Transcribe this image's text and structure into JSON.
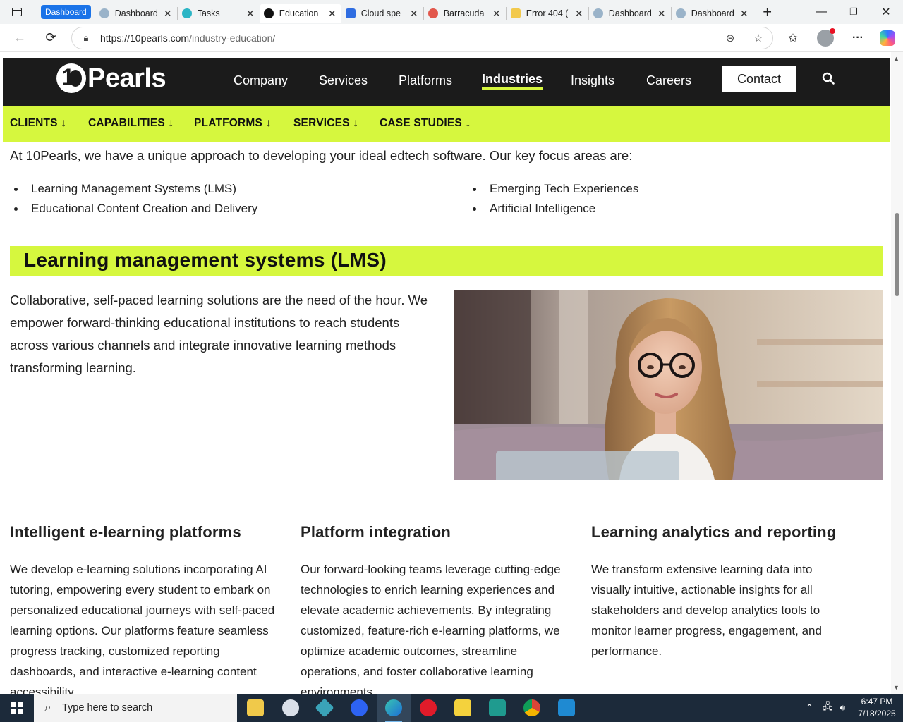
{
  "browser": {
    "group_label": "Dashboard",
    "tabs": [
      {
        "label": "Dashboard",
        "favicon_color": "#9ab3c9",
        "active": false
      },
      {
        "label": "Tasks",
        "favicon_color": "#2bb5c5",
        "active": false
      },
      {
        "label": "Education",
        "favicon_color": "#111111",
        "active": true
      },
      {
        "label": "Cloud spe",
        "favicon_color": "#2f6de1",
        "active": false
      },
      {
        "label": "Barracuda",
        "favicon_color": "#e2574c",
        "active": false
      },
      {
        "label": "Error 404 (",
        "favicon_color": "#f2c94c",
        "active": false
      },
      {
        "label": "Dashboard",
        "favicon_color": "#9ab3c9",
        "active": false
      },
      {
        "label": "Dashboard",
        "favicon_color": "#9ab3c9",
        "active": false
      }
    ],
    "url_host": "https://10pearls.com",
    "url_path": "/industry-education/"
  },
  "site": {
    "logo_text": "Pearls",
    "nav": [
      "Company",
      "Services",
      "Platforms",
      "Industries",
      "Insights",
      "Careers"
    ],
    "active_nav": "Industries",
    "contact_label": "Contact",
    "accent_color": "#d6f73e",
    "header_color": "#1b1b1b",
    "subnav": [
      "CLIENTS ↓",
      "CAPABILITIES ↓",
      "PLATFORMS ↓",
      "SERVICES ↓",
      "CASE STUDIES ↓"
    ]
  },
  "content": {
    "intro": "At 10Pearls, we have a unique approach to developing your ideal edtech software. Our key focus areas are:",
    "focus_left": [
      "Learning Management Systems (LMS)",
      "Educational Content Creation and Delivery"
    ],
    "focus_right": [
      "Emerging Tech Experiences",
      "Artificial Intelligence"
    ],
    "lms_heading": "Learning management systems (LMS)",
    "lms_text": "Collaborative, self-paced learning solutions are the need of the hour. We empower forward-thinking educational institutions to reach students across various channels and integrate innovative learning methods transforming learning.",
    "columns": [
      {
        "title": "Intelligent e-learning platforms",
        "text": "We develop e-learning solutions incorporating AI tutoring, empowering every student to embark on personalized educational journeys with self-paced learning options. Our platforms feature seamless progress tracking, customized reporting dashboards, and interactive e-learning content accessibility."
      },
      {
        "title": "Platform integration",
        "text": "Our forward-looking teams leverage cutting-edge technologies to enrich learning experiences and elevate academic achievements. By integrating customized, feature-rich e-learning platforms, we optimize academic outcomes, streamline operations, and foster collaborative learning environments."
      },
      {
        "title": "Learning analytics and reporting",
        "text": "We transform extensive learning data into visually intuitive, actionable insights for all stakeholders and develop analytics tools to monitor learner progress, engagement, and performance."
      }
    ]
  },
  "taskbar": {
    "search_placeholder": "Type here to search",
    "time": "6:47 PM",
    "date": "7/18/2025"
  }
}
